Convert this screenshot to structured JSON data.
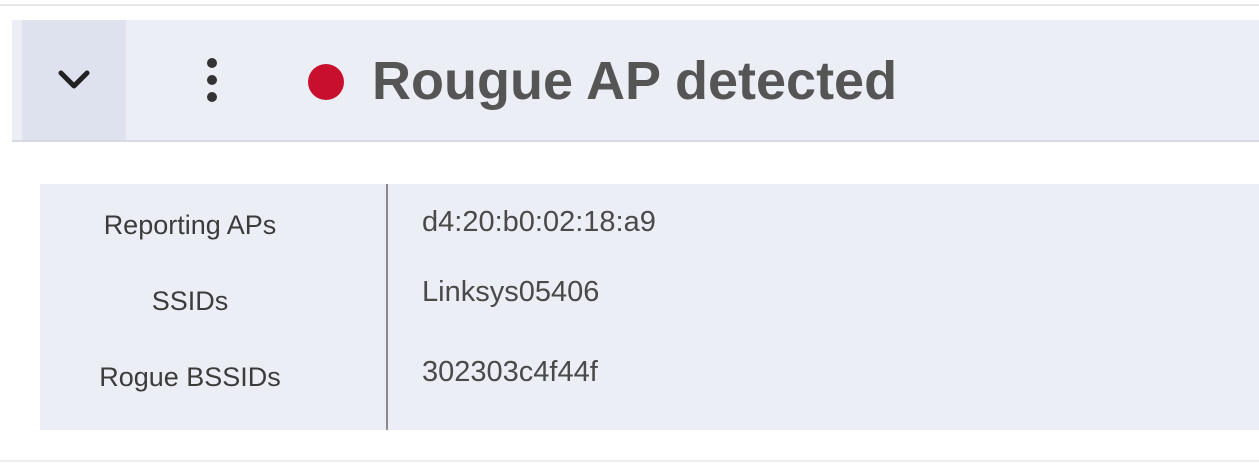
{
  "alert": {
    "title": "Rougue AP detected",
    "status_color": "#c8102e",
    "collapse_icon": "chevron-down-icon",
    "menu_icon": "more-vertical-icon"
  },
  "details": {
    "rows": [
      {
        "label": "Reporting APs",
        "value": "d4:20:b0:02:18:a9"
      },
      {
        "label": "SSIDs",
        "value": "Linksys05406"
      },
      {
        "label": "Rogue BSSIDs",
        "value": "302303c4f44f"
      }
    ]
  }
}
